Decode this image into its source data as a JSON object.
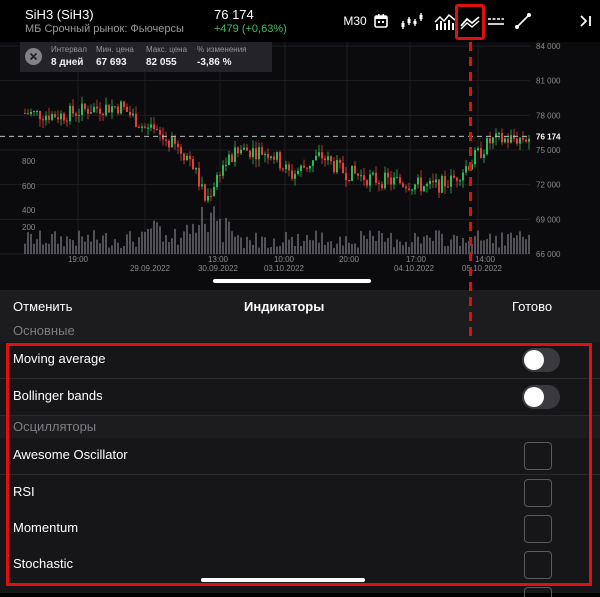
{
  "header": {
    "ticker": "SiH3 (SiH3)",
    "market": "МБ Срочный рынок: Фьючерсы",
    "price": "76 174",
    "change": "+479 (+0,63%)",
    "timeframe": "M30",
    "icons": [
      "calendar-icon",
      "chart-type-icon",
      "indicators-icon",
      "trend-icon",
      "levels-icon",
      "draw-line-icon",
      "collapse-icon"
    ]
  },
  "info_panel": {
    "interval_label": "Интервал",
    "interval_value": "8 дней",
    "min_label": "Мин. цена",
    "min_value": "67 693",
    "max_label": "Макс. цена",
    "max_value": "82 055",
    "change_label": "% изменения",
    "change_value": "-3,86 %"
  },
  "chart_data": {
    "type": "candlestick",
    "price_ticks": [
      "84 000",
      "81 000",
      "78 000",
      "75 000",
      "72 000",
      "69 000",
      "66 000"
    ],
    "current_price_label": "76 174",
    "volume_ticks": [
      "800",
      "600",
      "400",
      "200"
    ],
    "time_labels": [
      "19:00",
      "13:00",
      "10:00",
      "20:00",
      "17:00",
      "14:00"
    ],
    "date_labels": [
      "29.09.2022",
      "30.09.2022",
      "03.10.2022",
      "04.10.2022",
      "05.10.2022"
    ],
    "ylim": [
      66000,
      84000
    ],
    "colors": {
      "up": "#2eb856",
      "down": "#e0403a"
    }
  },
  "sheet": {
    "cancel": "Отменить",
    "title": "Индикаторы",
    "done": "Готово",
    "section_main": "Основные",
    "moving_average": "Moving average",
    "bollinger": "Bollinger bands",
    "section_osc": "Осцилляторы",
    "awesome": "Awesome Oscillator",
    "rsi": "RSI",
    "momentum": "Momentum",
    "stochastic": "Stochastic"
  }
}
